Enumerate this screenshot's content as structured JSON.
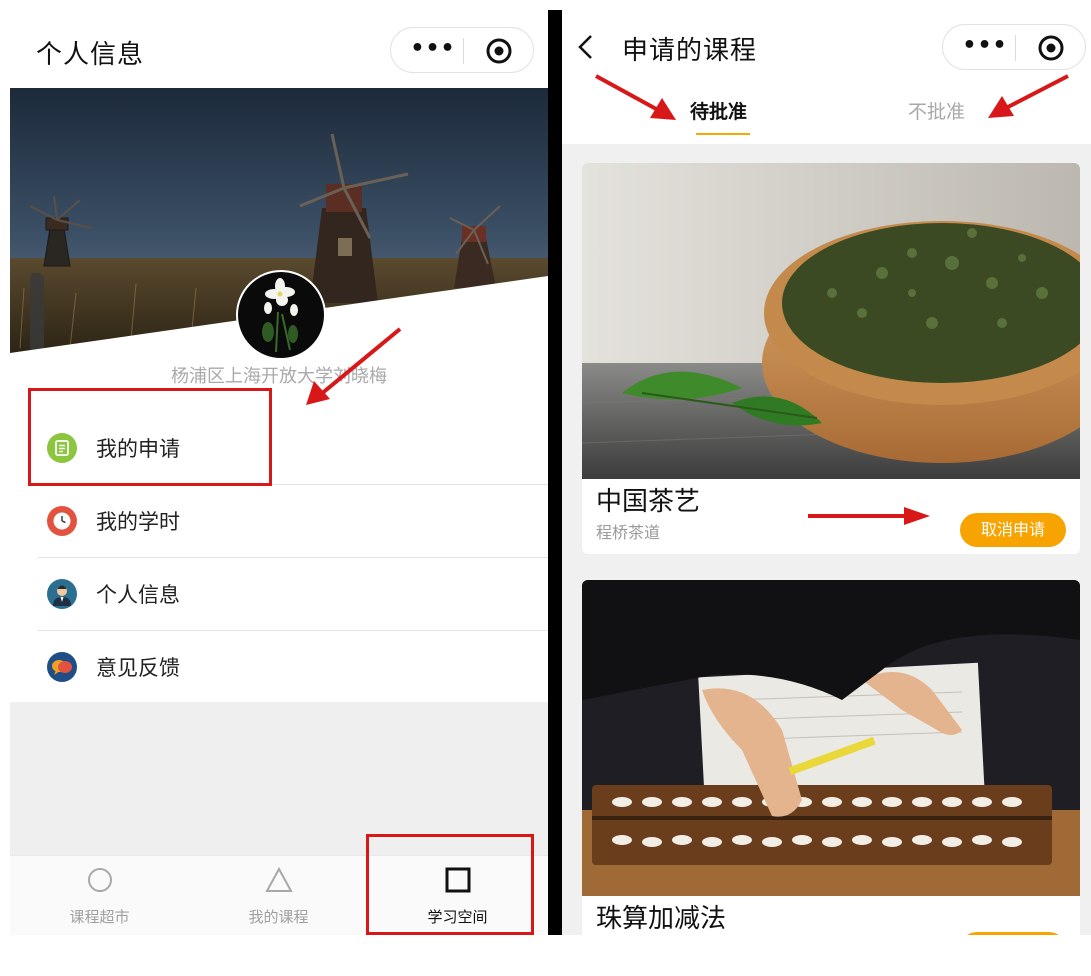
{
  "left": {
    "nav_title": "个人信息",
    "capsule_more": "•••",
    "user_name": "杨浦区上海开放大学刘晓梅",
    "menu": [
      {
        "label": "我的申请",
        "icon": "document-icon",
        "color": "#8cc63f"
      },
      {
        "label": "我的学时",
        "icon": "clock-icon",
        "color": "#e2533f"
      },
      {
        "label": "个人信息",
        "icon": "person-icon",
        "color": "#2a6f8f"
      },
      {
        "label": "意见反馈",
        "icon": "speech-bubbles-icon",
        "color": "#f0a020"
      }
    ],
    "tabs": [
      {
        "label": "课程超市",
        "icon": "circle-icon",
        "active": false
      },
      {
        "label": "我的课程",
        "icon": "triangle-icon",
        "active": false
      },
      {
        "label": "学习空间",
        "icon": "square-icon",
        "active": true
      }
    ]
  },
  "right": {
    "nav_title": "申请的课程",
    "back_icon": "chevron-left-icon",
    "capsule_more": "•••",
    "segments": [
      {
        "label": "待批准",
        "active": true
      },
      {
        "label": "不批准",
        "active": false
      }
    ],
    "courses": [
      {
        "title": "中国茶艺",
        "subtitle": "程桥茶道",
        "button": "取消申请",
        "image": "green-tea-in-wooden-bowl"
      },
      {
        "title": "珠算加减法",
        "subtitle": "",
        "button": "",
        "image": "child-using-abacus"
      }
    ]
  },
  "colors": {
    "accent": "#f7a400",
    "annotation_red": "#d81818"
  }
}
